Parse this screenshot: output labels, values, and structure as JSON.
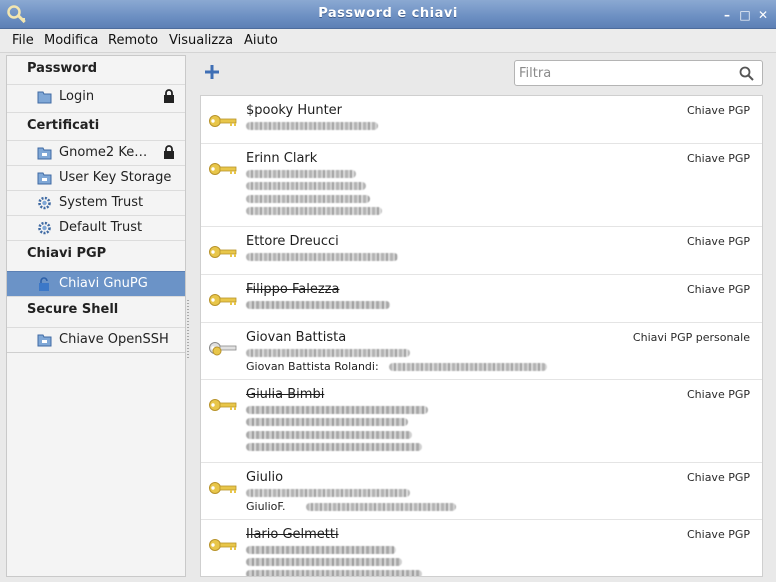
{
  "window": {
    "title": "Password e chiavi"
  },
  "menu": [
    "File",
    "Modifica",
    "Remoto",
    "Visualizza",
    "Aiuto"
  ],
  "sidebar": {
    "sections": [
      {
        "title": "Password",
        "items": [
          {
            "label": "Login",
            "icon": "folder-icon",
            "locked": true
          }
        ]
      },
      {
        "title": "Certificati",
        "items": [
          {
            "label": "Gnome2 Ke…",
            "icon": "keyring-folder-icon",
            "locked": true
          },
          {
            "label": "User Key Storage",
            "icon": "keyring-folder-icon",
            "locked": false
          },
          {
            "label": "System Trust",
            "icon": "gear-icon",
            "locked": false
          },
          {
            "label": "Default Trust",
            "icon": "gear-icon",
            "locked": false
          }
        ]
      },
      {
        "title": "Chiavi PGP",
        "items": [
          {
            "label": "Chiavi GnuPG",
            "icon": "lock-open-icon",
            "locked": false,
            "selected": true
          }
        ]
      },
      {
        "title": "Secure Shell",
        "items": [
          {
            "label": "Chiave OpenSSH",
            "icon": "keyring-folder-icon",
            "locked": false
          }
        ]
      }
    ]
  },
  "toolbar": {
    "search_placeholder": "Filtra"
  },
  "keys": [
    {
      "name": "$pooky Hunter",
      "type": "Chiave PGP",
      "revoked": false
    },
    {
      "name": "Erinn Clark",
      "type": "Chiave PGP",
      "revoked": false
    },
    {
      "name": "Ettore Dreucci",
      "type": "Chiave PGP",
      "revoked": false
    },
    {
      "name": "Filippo Falezza",
      "type": "Chiave PGP",
      "revoked": true
    },
    {
      "name": "Giovan Battista",
      "type": "Chiavi PGP personale",
      "revoked": false,
      "subtext": "Giovan Battista Rolandi:"
    },
    {
      "name": "Giulia Bimbi",
      "type": "Chiave PGP",
      "revoked": true
    },
    {
      "name": "Giulio",
      "type": "Chiave PGP",
      "revoked": false,
      "subtext": "GiulioF."
    },
    {
      "name": "Ilario Gelmetti",
      "type": "Chiave PGP",
      "revoked": true
    }
  ],
  "colors": {
    "titlebar": "#6c8fc2",
    "selection": "#6b93c7",
    "key": "#e8c64a"
  }
}
